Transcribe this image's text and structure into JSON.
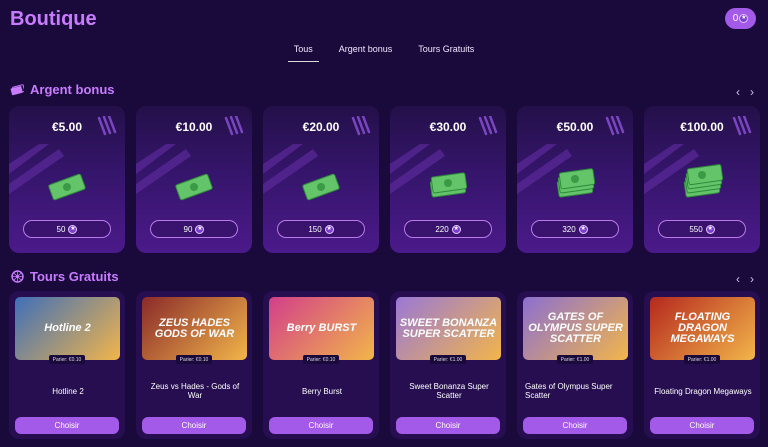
{
  "header": {
    "title": "Boutique",
    "balance": "0",
    "coin_glyph": "★"
  },
  "tabs": [
    {
      "label": "Tous"
    },
    {
      "label": "Argent bonus"
    },
    {
      "label": "Tours Gratuits"
    }
  ],
  "bonus": {
    "title": "Argent bonus",
    "icon": "cash-icon",
    "cards": [
      {
        "amount": "€5.00",
        "points": "50"
      },
      {
        "amount": "€10.00",
        "points": "90"
      },
      {
        "amount": "€20.00",
        "points": "150"
      },
      {
        "amount": "€30.00",
        "points": "220"
      },
      {
        "amount": "€50.00",
        "points": "320"
      },
      {
        "amount": "€100.00",
        "points": "550"
      }
    ]
  },
  "spins": {
    "title": "Tours Gratuits",
    "icon": "wheel-icon",
    "choose_label": "Choisir",
    "games": [
      {
        "name": "Hotline 2",
        "bet": "Parier: €0.10",
        "art": "Hotline 2",
        "bg": "#3f6fb8"
      },
      {
        "name": "Zeus vs Hades - Gods of War",
        "bet": "Parier: €0.10",
        "art": "ZEUS HADES GODS OF WAR",
        "bg": "#8a2a2a"
      },
      {
        "name": "Berry Burst",
        "bet": "Parier: €0.10",
        "art": "Berry BURST",
        "bg": "#d23f8a"
      },
      {
        "name": "Sweet Bonanza Super Scatter",
        "bet": "Parier: €1.00",
        "art": "SWEET BONANZA SUPER SCATTER",
        "bg": "#9a78d6"
      },
      {
        "name": "Gates of Olympus Super Scatter",
        "bet": "Parier: €1.00",
        "art": "GATES OF OLYMPUS SUPER SCATTER",
        "bg": "#8c6fd0"
      },
      {
        "name": "Floating Dragon Megaways",
        "bet": "Parier: €1.00",
        "art": "FLOATING DRAGON MEGAWAYS",
        "bg": "#b5281e"
      }
    ]
  },
  "colors": {
    "accent": "#c97bff",
    "button": "#a45ae8",
    "background": "#1a0a3c"
  }
}
